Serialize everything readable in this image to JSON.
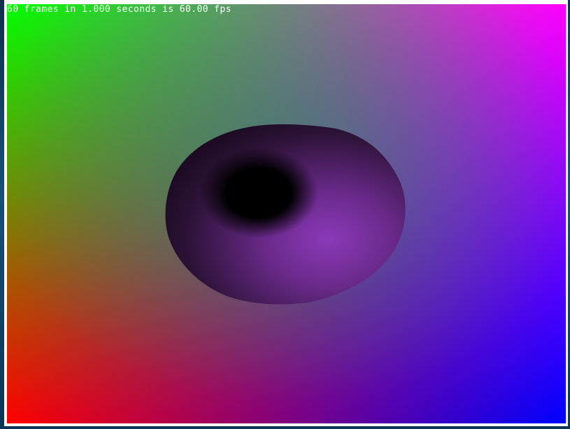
{
  "window": {
    "fps_text": "60 frames in 1.000 seconds is 60.00 fps"
  },
  "scene": {
    "corner_colors": {
      "top_left": "#00ff00",
      "top_right": "#ff00ff",
      "bottom_left": "#ff0000",
      "bottom_right": "#0000ff"
    },
    "center_tint": "#3a8a7a",
    "ellipsoid_light": "#8a3ab8",
    "ellipsoid_dark": "#000000"
  }
}
